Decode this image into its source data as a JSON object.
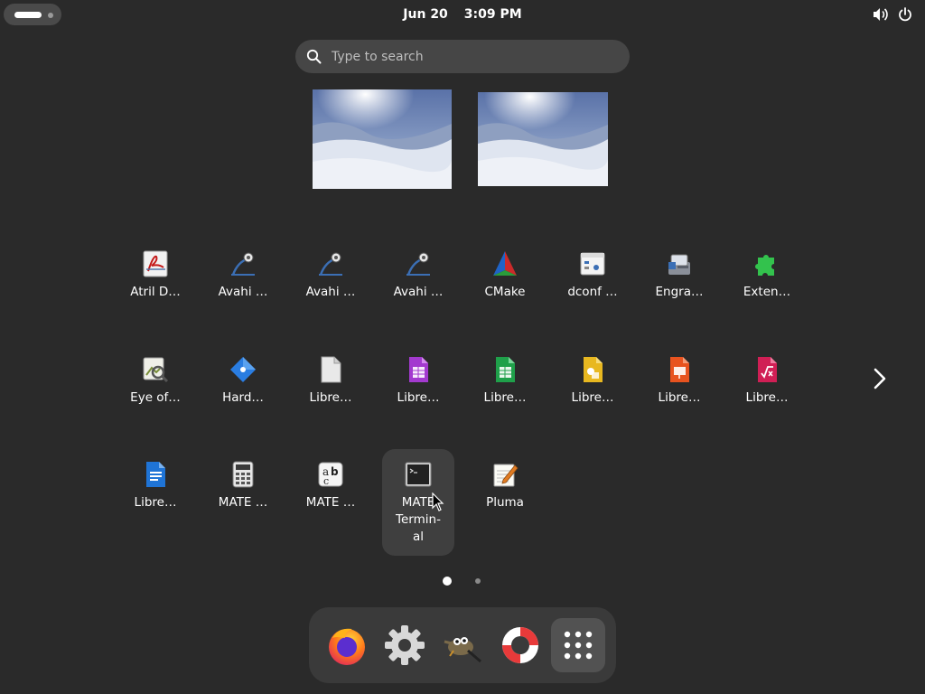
{
  "topbar": {
    "date": "Jun 20",
    "time": "3:09 PM",
    "icons": [
      "activities-indicator",
      "volume-icon",
      "power-icon"
    ]
  },
  "search": {
    "placeholder": "Type to search",
    "value": ""
  },
  "workspaces": [
    "workspace-1",
    "workspace-2"
  ],
  "apps": [
    {
      "label": "Atril D…",
      "icon": "atril-document-viewer-icon"
    },
    {
      "label": "Avahi …",
      "icon": "avahi-icon"
    },
    {
      "label": "Avahi …",
      "icon": "avahi-icon"
    },
    {
      "label": "Avahi …",
      "icon": "avahi-icon"
    },
    {
      "label": "CMake",
      "icon": "cmake-icon"
    },
    {
      "label": "dconf …",
      "icon": "dconf-editor-icon"
    },
    {
      "label": "Engra…",
      "icon": "engrampa-icon"
    },
    {
      "label": "Exten…",
      "icon": "extensions-icon"
    },
    {
      "label": "Eye of…",
      "icon": "eye-of-mate-icon"
    },
    {
      "label": "Hard…",
      "icon": "hardinfo-icon"
    },
    {
      "label": "Libre…",
      "icon": "libreoffice-icon"
    },
    {
      "label": "Libre…",
      "icon": "libreoffice-base-icon"
    },
    {
      "label": "Libre…",
      "icon": "libreoffice-calc-icon"
    },
    {
      "label": "Libre…",
      "icon": "libreoffice-draw-icon"
    },
    {
      "label": "Libre…",
      "icon": "libreoffice-impress-icon"
    },
    {
      "label": "Libre…",
      "icon": "libreoffice-math-icon"
    },
    {
      "label": "Libre…",
      "icon": "libreoffice-writer-icon"
    },
    {
      "label": "MATE …",
      "icon": "calculator-icon"
    },
    {
      "label": "MATE …",
      "icon": "character-map-icon"
    },
    {
      "label": "MATE\nTermin-\nal",
      "icon": "terminal-icon"
    },
    {
      "label": "Pluma",
      "icon": "pluma-text-editor-icon"
    }
  ],
  "pagination": {
    "current": 1,
    "total": 2
  },
  "dock": [
    {
      "name": "firefox",
      "icon": "firefox-icon"
    },
    {
      "name": "settings",
      "icon": "gear-icon"
    },
    {
      "name": "gimp",
      "icon": "gimp-icon"
    },
    {
      "name": "help",
      "icon": "lifebuoy-icon"
    },
    {
      "name": "show-apps",
      "icon": "app-grid-icon"
    }
  ],
  "colors": {
    "background": "#2a2a2a",
    "search_bg": "#464646",
    "dock_bg": "#3a3a3a",
    "active_tile": "#3f3f3f"
  }
}
